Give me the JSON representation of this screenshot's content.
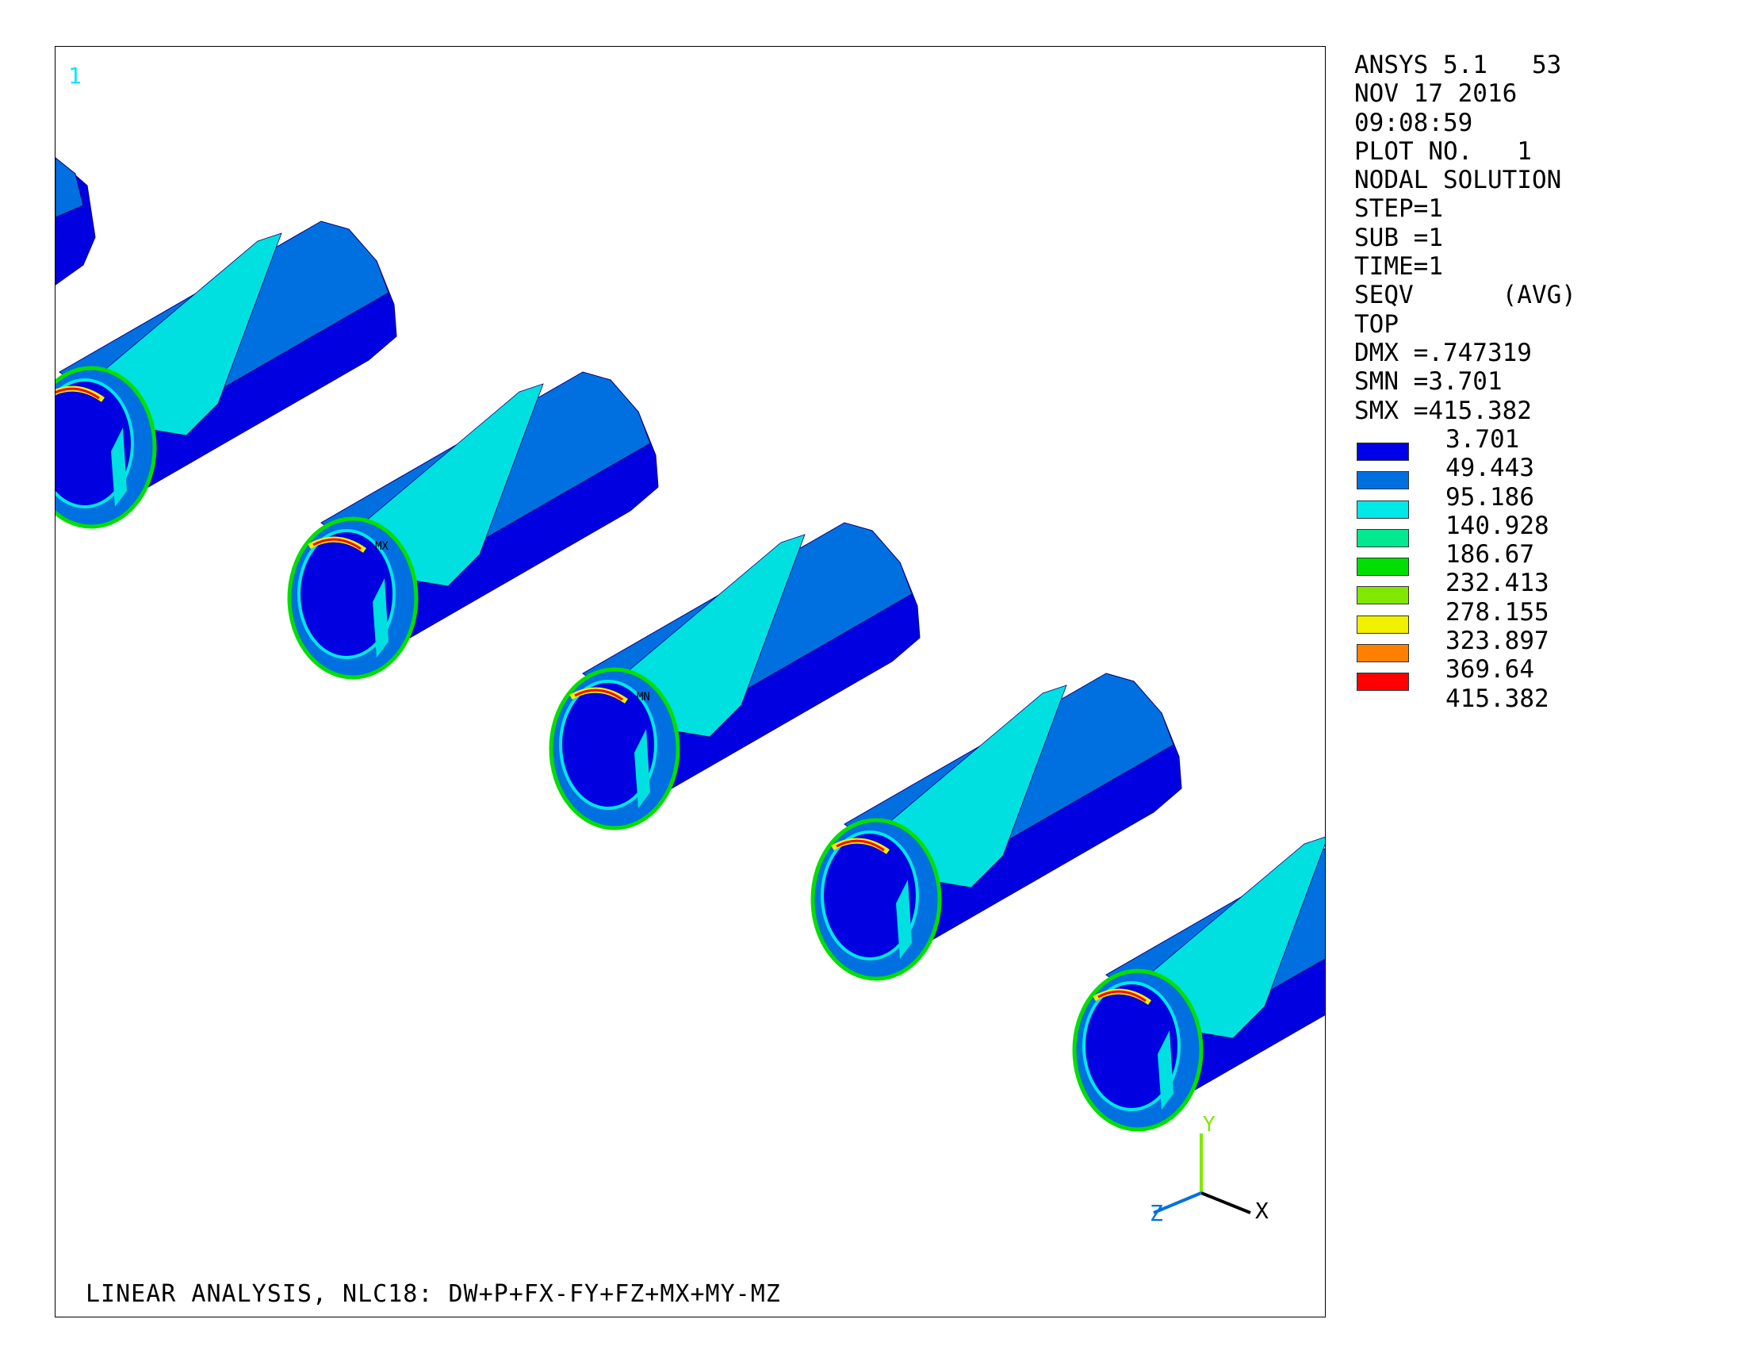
{
  "window_number": "1",
  "info_lines": [
    "ANSYS 5.1   53",
    "NOV 17 2016",
    "09:08:59",
    "PLOT NO.   1",
    "NODAL SOLUTION",
    "STEP=1",
    "SUB =1",
    "TIME=1",
    "SEQV      (AVG)",
    "TOP",
    "DMX =.747319",
    "SMN =3.701",
    "SMX =415.382"
  ],
  "legend": {
    "values": [
      "3.701",
      "49.443",
      "95.186",
      "140.928",
      "186.67",
      "232.413",
      "278.155",
      "323.897",
      "369.64",
      "415.382"
    ],
    "colors": [
      "#0000e8",
      "#0070e0",
      "#00e8e8",
      "#00e890",
      "#00e000",
      "#80e800",
      "#f0f000",
      "#ff8000",
      "#ff0000"
    ]
  },
  "labels": {
    "max": "MX",
    "min": "MN"
  },
  "triad": {
    "x": "X",
    "y": "Y",
    "z": "Z"
  },
  "bottom_title": "LINEAR ANALYSIS, NLC18: DW+P+FX-FY+FZ+MX+MY-MZ",
  "palette": {
    "dark_blue": "#0000e0",
    "mid_blue": "#0070e0",
    "cyan": "#00e0e0",
    "dark_edge": "#000080"
  }
}
